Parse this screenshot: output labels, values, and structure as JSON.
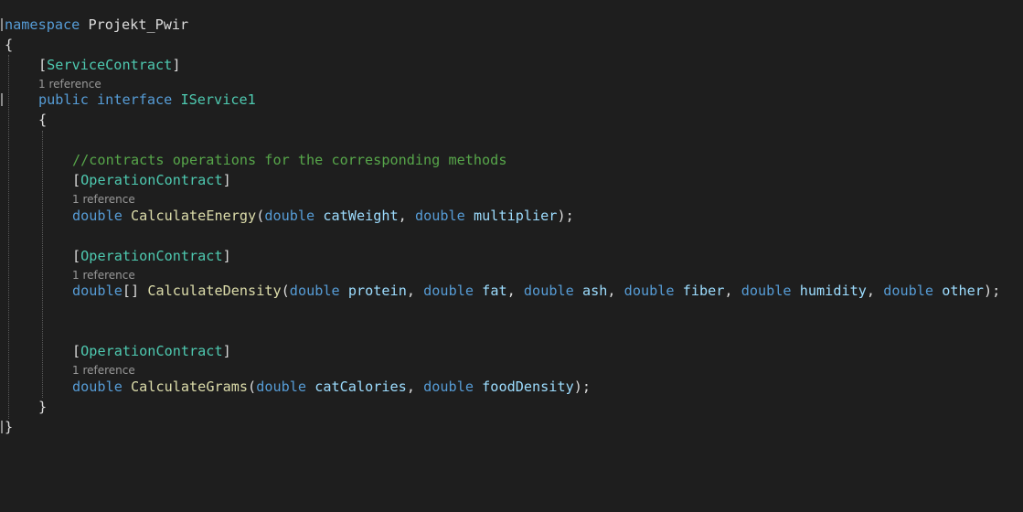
{
  "code": {
    "ns_keyword": "namespace",
    "ns_name": "Projekt_Pwir",
    "open_brace_ns": "{",
    "attr_service": "ServiceContract",
    "ref_service": "1 reference",
    "kw_public": "public",
    "kw_interface": "interface",
    "iface_name": "IService1",
    "open_brace_iface": "{",
    "comment": "//contracts operations for the corresponding methods",
    "op1": {
      "attr": "OperationContract",
      "ref": "1 reference",
      "ret": "double",
      "name": "CalculateEnergy",
      "params": [
        {
          "type": "double",
          "name": "catWeight"
        },
        {
          "type": "double",
          "name": "multiplier"
        }
      ]
    },
    "op2": {
      "attr": "OperationContract",
      "ref": "1 reference",
      "ret": "double",
      "ret_suffix": "[]",
      "name": "CalculateDensity",
      "params": [
        {
          "type": "double",
          "name": "protein"
        },
        {
          "type": "double",
          "name": "fat"
        },
        {
          "type": "double",
          "name": "ash"
        },
        {
          "type": "double",
          "name": "fiber"
        },
        {
          "type": "double",
          "name": "humidity"
        },
        {
          "type": "double",
          "name": "other"
        }
      ]
    },
    "op3": {
      "attr": "OperationContract",
      "ref": "1 reference",
      "ret": "double",
      "name": "CalculateGrams",
      "params": [
        {
          "type": "double",
          "name": "catCalories"
        },
        {
          "type": "double",
          "name": "foodDensity"
        }
      ]
    },
    "close_brace_iface": "}",
    "close_brace_ns": "}"
  },
  "colors": {
    "background": "#1e1e1e",
    "keyword": "#569cd6",
    "type": "#4ec9b0",
    "method": "#dcdcaa",
    "parameter": "#9cdcfe",
    "comment": "#57a64a",
    "codelens": "#999999"
  }
}
